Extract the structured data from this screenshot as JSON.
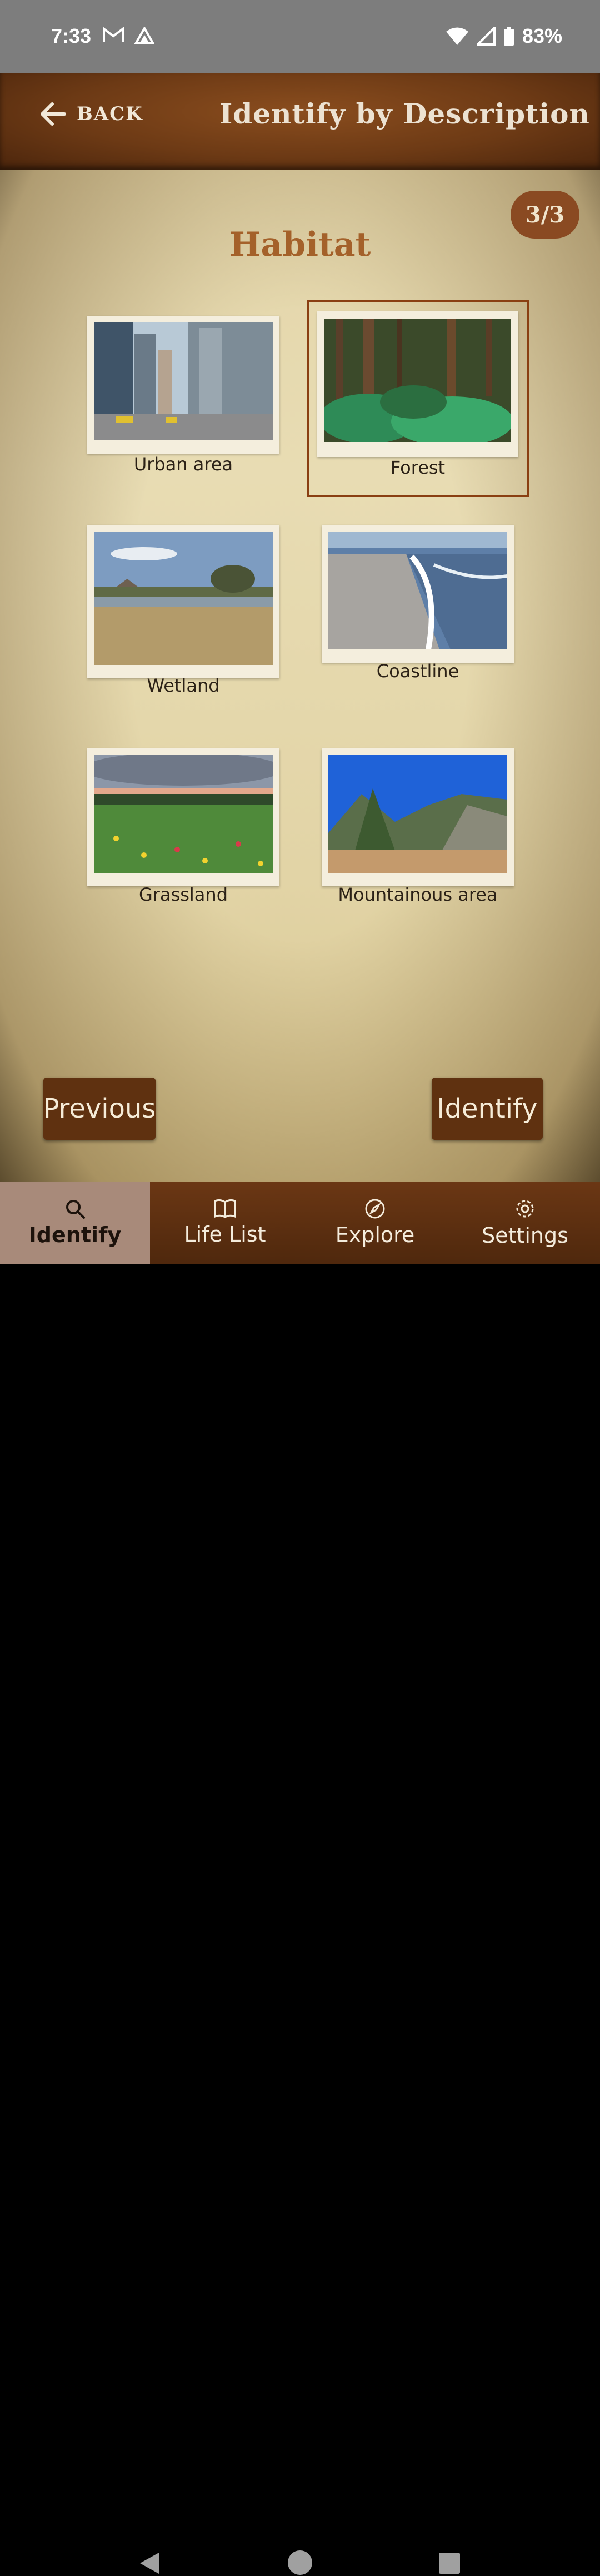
{
  "status_bar": {
    "time": "7:33",
    "battery": "83%"
  },
  "header": {
    "back_label": "BACK",
    "title": "Identify by Description"
  },
  "page_counter": "3/3",
  "section_title": "Habitat",
  "habitats": [
    {
      "label": "Urban area"
    },
    {
      "label": "Forest"
    },
    {
      "label": "Wetland"
    },
    {
      "label": "Coastline"
    },
    {
      "label": "Grassland"
    },
    {
      "label": "Mountainous area"
    }
  ],
  "selected_habitat": "Forest",
  "buttons": {
    "previous": "Previous",
    "identify": "Identify"
  },
  "bottom_nav": [
    {
      "label": "Identify",
      "icon": "search-icon"
    },
    {
      "label": "Life List",
      "icon": "book-icon"
    },
    {
      "label": "Explore",
      "icon": "compass-icon"
    },
    {
      "label": "Settings",
      "icon": "gear-icon"
    }
  ]
}
